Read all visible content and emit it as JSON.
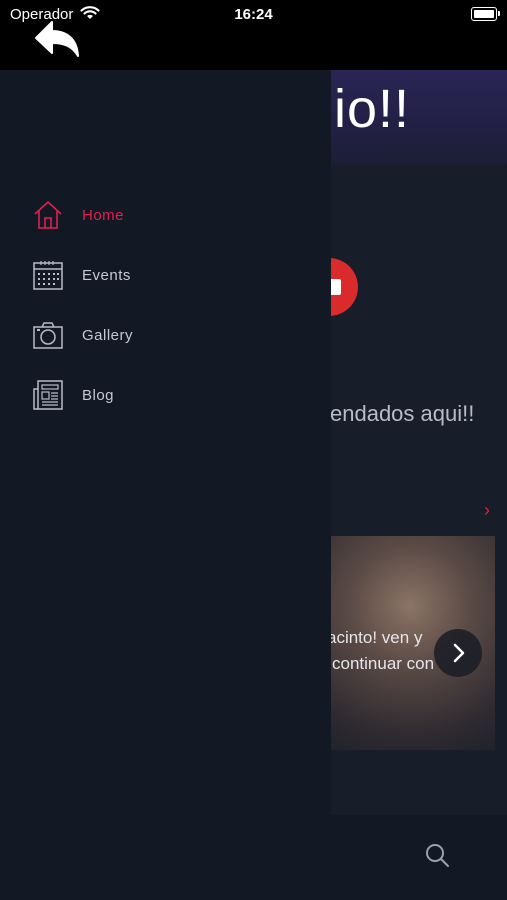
{
  "status_bar": {
    "carrier": "Operador",
    "time": "16:24"
  },
  "background": {
    "hero_text": "io!!",
    "recommended_text": "endados aqui!!",
    "card_line1": "acinto! ven y",
    "card_line2": "continuar con"
  },
  "drawer": {
    "items": [
      {
        "label": "Home",
        "icon": "home-icon",
        "active": true
      },
      {
        "label": "Events",
        "icon": "calendar-icon",
        "active": false
      },
      {
        "label": "Gallery",
        "icon": "camera-icon",
        "active": false
      },
      {
        "label": "Blog",
        "icon": "newspaper-icon",
        "active": false
      }
    ]
  },
  "colors": {
    "accent": "#e0214d",
    "drawer_bg": "#121824",
    "text": "#c5c9d3"
  }
}
